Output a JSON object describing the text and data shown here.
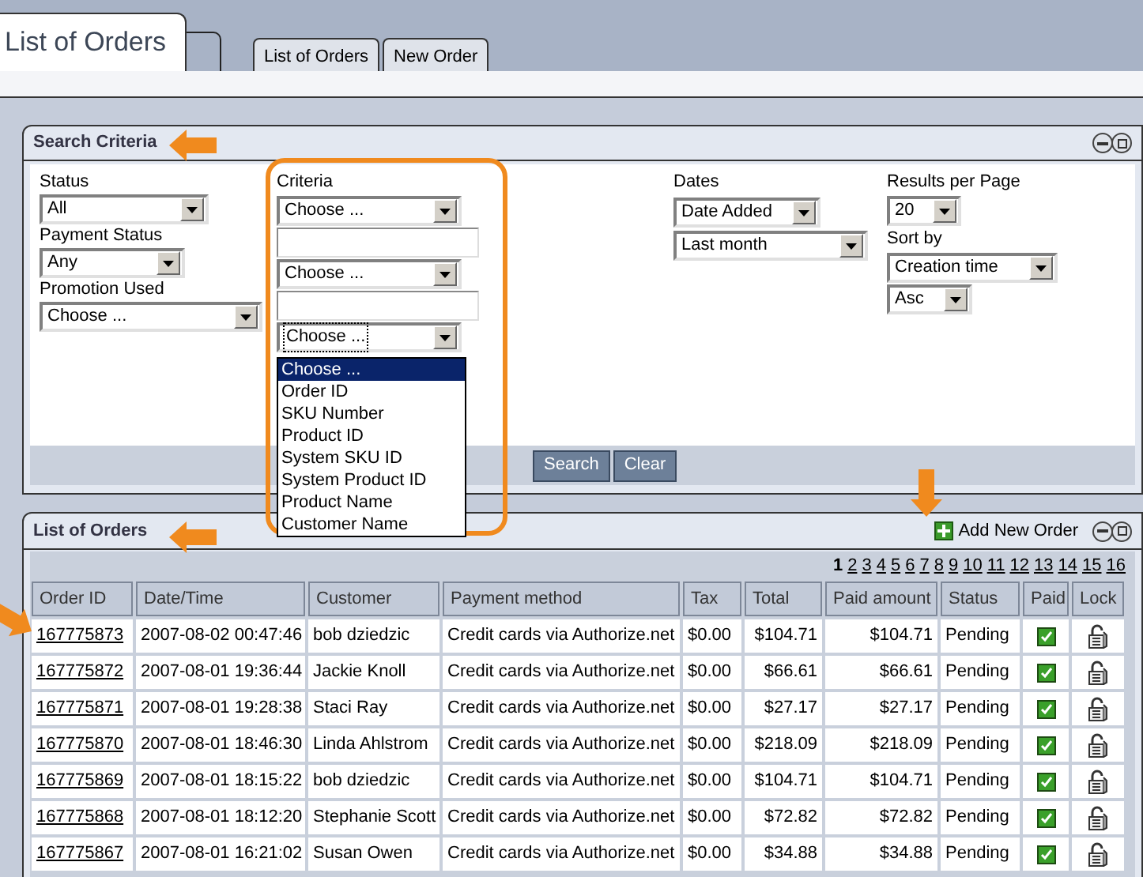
{
  "top_tabs": [
    {
      "label": "List of Orders",
      "kind": "title"
    },
    {
      "label": "List of Orders",
      "kind": "tab"
    },
    {
      "label": "New Order",
      "kind": "tab"
    }
  ],
  "search": {
    "title": "Search Criteria",
    "status": {
      "label": "Status",
      "value": "All"
    },
    "payment_status": {
      "label": "Payment Status",
      "value": "Any"
    },
    "promotion_used": {
      "label": "Promotion Used",
      "value": "Choose ..."
    },
    "criteria": {
      "label": "Criteria",
      "rows": [
        {
          "kind": "select",
          "value": "Choose ..."
        },
        {
          "kind": "input"
        },
        {
          "kind": "select",
          "value": "Choose ..."
        },
        {
          "kind": "input"
        },
        {
          "kind": "select",
          "value": "Choose ...",
          "focused": true
        }
      ],
      "dropdown": {
        "open": true,
        "options": [
          {
            "label": "Choose ...",
            "selected": true
          },
          {
            "label": "Order ID",
            "selected": false
          },
          {
            "label": "SKU Number",
            "selected": false
          },
          {
            "label": "Product ID",
            "selected": false
          },
          {
            "label": "System SKU ID",
            "selected": false
          },
          {
            "label": "System Product ID",
            "selected": false
          },
          {
            "label": "Product Name",
            "selected": false
          },
          {
            "label": "Customer Name",
            "selected": false
          }
        ]
      }
    },
    "dates": {
      "label": "Dates",
      "field": "Date Added",
      "range": "Last month"
    },
    "results_per_page": {
      "label": "Results per Page",
      "value": "20"
    },
    "sort_by": {
      "label": "Sort by",
      "field": "Creation time",
      "order": "Asc"
    },
    "buttons": [
      "Search",
      "Clear"
    ]
  },
  "orders": {
    "title": "List of Orders",
    "add_button": "Add New Order",
    "pages": [
      {
        "label": "1",
        "selected": true
      },
      {
        "label": "2",
        "selected": false
      },
      {
        "label": "3",
        "selected": false
      },
      {
        "label": "4",
        "selected": false
      },
      {
        "label": "5",
        "selected": false
      },
      {
        "label": "6",
        "selected": false
      },
      {
        "label": "7",
        "selected": false
      },
      {
        "label": "8",
        "selected": false
      },
      {
        "label": "9",
        "selected": false
      },
      {
        "label": "10",
        "selected": false
      },
      {
        "label": "11",
        "selected": false
      },
      {
        "label": "12",
        "selected": false
      },
      {
        "label": "13",
        "selected": false
      },
      {
        "label": "14",
        "selected": false
      },
      {
        "label": "15",
        "selected": false
      },
      {
        "label": "16",
        "selected": false
      }
    ],
    "columns": [
      "Order ID",
      "Date/Time",
      "Customer",
      "Payment method",
      "Tax",
      "Total",
      "Paid amount",
      "Status",
      "Paid",
      "Lock"
    ],
    "rows": [
      {
        "order_id": "167775873",
        "date": "2007-08-02 00:47:46",
        "customer": "bob dziedzic",
        "payment": "Credit cards via Authorize.net",
        "tax": "$0.00",
        "total": "$104.71",
        "paid_amount": "$104.71",
        "status": "Pending",
        "paid": true
      },
      {
        "order_id": "167775872",
        "date": "2007-08-01 19:36:44",
        "customer": "Jackie Knoll",
        "payment": "Credit cards via Authorize.net",
        "tax": "$0.00",
        "total": "$66.61",
        "paid_amount": "$66.61",
        "status": "Pending",
        "paid": true
      },
      {
        "order_id": "167775871",
        "date": "2007-08-01 19:28:38",
        "customer": "Staci Ray",
        "payment": "Credit cards via Authorize.net",
        "tax": "$0.00",
        "total": "$27.17",
        "paid_amount": "$27.17",
        "status": "Pending",
        "paid": true
      },
      {
        "order_id": "167775870",
        "date": "2007-08-01 18:46:30",
        "customer": "Linda Ahlstrom",
        "payment": "Credit cards via Authorize.net",
        "tax": "$0.00",
        "total": "$218.09",
        "paid_amount": "$218.09",
        "status": "Pending",
        "paid": true
      },
      {
        "order_id": "167775869",
        "date": "2007-08-01 18:15:22",
        "customer": "bob dziedzic",
        "payment": "Credit cards via Authorize.net",
        "tax": "$0.00",
        "total": "$104.71",
        "paid_amount": "$104.71",
        "status": "Pending",
        "paid": true
      },
      {
        "order_id": "167775868",
        "date": "2007-08-01 18:12:20",
        "customer": "Stephanie Scott",
        "payment": "Credit cards via Authorize.net",
        "tax": "$0.00",
        "total": "$72.82",
        "paid_amount": "$72.82",
        "status": "Pending",
        "paid": true
      },
      {
        "order_id": "167775867",
        "date": "2007-08-01 16:21:02",
        "customer": "Susan Owen",
        "payment": "Credit cards via Authorize.net",
        "tax": "$0.00",
        "total": "$34.88",
        "paid_amount": "$34.88",
        "status": "Pending",
        "paid": true
      }
    ]
  }
}
